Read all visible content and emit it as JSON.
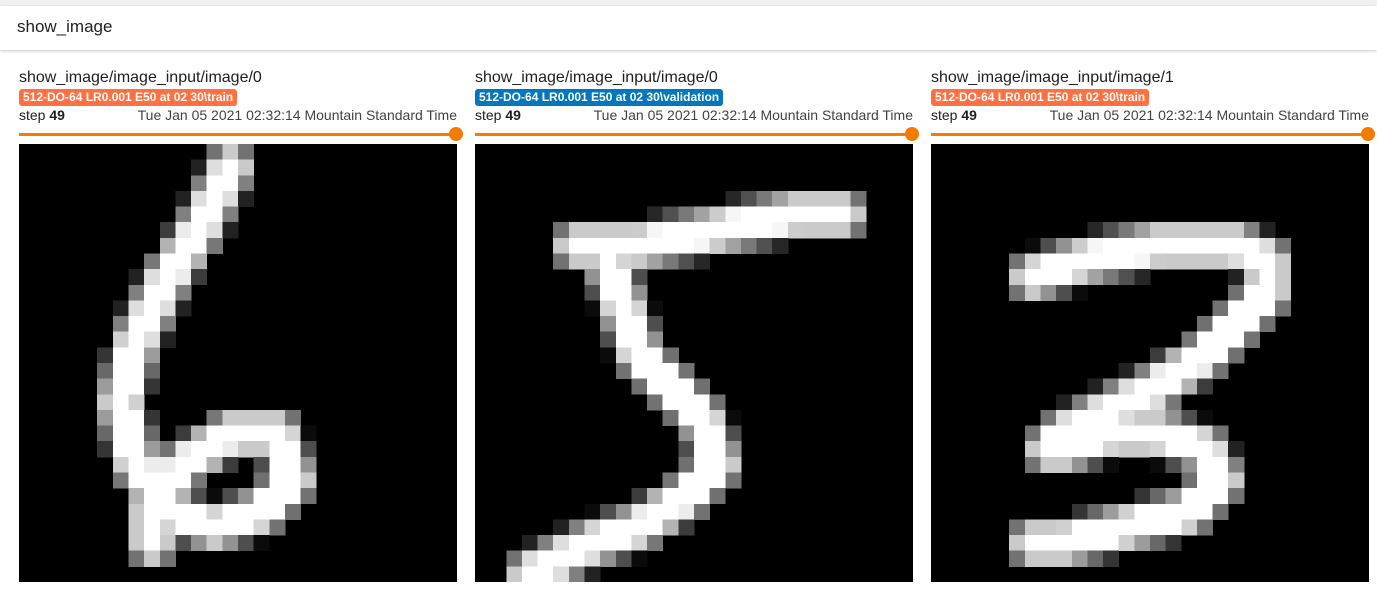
{
  "section": {
    "title": "show_image"
  },
  "accent_color": "#f57c00",
  "cards": [
    {
      "title": "show_image/image_input/image/0",
      "run": "512-DO-64 LR0.001 E50 at 02 30\\train",
      "run_color": "#ff7043",
      "step_label": "step",
      "step": "49",
      "timestamp": "Tue Jan 05 2021 02:32:14 Mountain Standard Time",
      "image_content": "handwritten digit 6",
      "digit_strokes": [
        [
          [
            13,
            1
          ],
          [
            11,
            5
          ],
          [
            9,
            8
          ],
          [
            7,
            12
          ],
          [
            6,
            16
          ],
          [
            7,
            20
          ],
          [
            9,
            23
          ],
          [
            12,
            24
          ],
          [
            15,
            23
          ],
          [
            17,
            21
          ],
          [
            16,
            18
          ],
          [
            13,
            18
          ],
          [
            10,
            20
          ],
          [
            8,
            23
          ],
          [
            8,
            25
          ]
        ]
      ]
    },
    {
      "title": "show_image/image_input/image/0",
      "run": "512-DO-64 LR0.001 E50 at 02 30\\validation",
      "run_color": "#0277bd",
      "step_label": "step",
      "step": "49",
      "timestamp": "Tue Jan 05 2021 02:32:14 Mountain Standard Time",
      "image_content": "handwritten digit 5",
      "digit_strokes": [
        [
          [
            6,
            6
          ],
          [
            10,
            6
          ],
          [
            15,
            5
          ],
          [
            20,
            4
          ],
          [
            23,
            4
          ]
        ],
        [
          [
            8,
            7
          ],
          [
            9,
            10
          ],
          [
            10,
            13
          ],
          [
            12,
            15
          ],
          [
            14,
            17
          ],
          [
            15,
            20
          ],
          [
            13,
            22
          ],
          [
            10,
            24
          ],
          [
            7,
            25
          ],
          [
            5,
            26
          ],
          [
            3,
            27
          ]
        ]
      ]
    },
    {
      "title": "show_image/image_input/image/1",
      "run": "512-DO-64 LR0.001 E50 at 02 30\\train",
      "run_color": "#ff7043",
      "step_label": "step",
      "step": "49",
      "timestamp": "Tue Jan 05 2021 02:32:14 Mountain Standard Time",
      "image_content": "handwritten digit 3",
      "digit_strokes": [
        [
          [
            6,
            8
          ],
          [
            9,
            7
          ],
          [
            14,
            6
          ],
          [
            19,
            6
          ],
          [
            21,
            7
          ],
          [
            21,
            9
          ],
          [
            19,
            11
          ],
          [
            17,
            13
          ],
          [
            14,
            15
          ],
          [
            10,
            17
          ],
          [
            8,
            18
          ],
          [
            7,
            19
          ]
        ],
        [
          [
            8,
            19
          ],
          [
            11,
            18
          ],
          [
            14,
            18
          ],
          [
            17,
            19
          ],
          [
            18,
            21
          ],
          [
            16,
            23
          ],
          [
            12,
            24
          ],
          [
            8,
            25
          ],
          [
            6,
            25
          ]
        ]
      ]
    }
  ]
}
